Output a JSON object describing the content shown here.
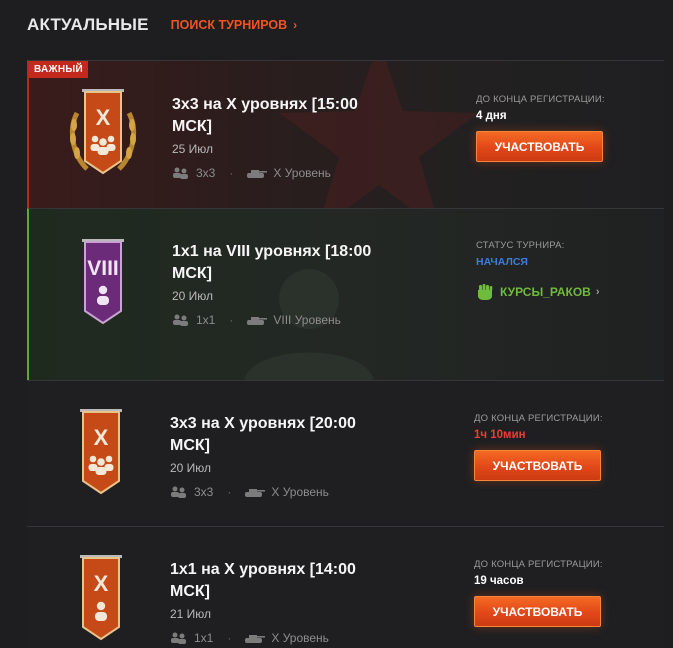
{
  "header": {
    "title": "АКТУАЛЬНЫЕ",
    "search_link": "ПОИСК ТУРНИРОВ"
  },
  "colors": {
    "accent": "#f25322",
    "important": "#c32a1d",
    "started": "#5ea83a",
    "button": "#e2471a",
    "time_urgent": "#f03c33",
    "status_blue": "#3d7fd6"
  },
  "tournaments": [
    {
      "badge": "ВАЖНЫЙ",
      "emblem_tier": "X",
      "emblem_icon": "team-three-icon",
      "title": "3x3 на X уровнях [15:00 МСК]",
      "date": "25 Июл",
      "format": "3x3",
      "tier": "X Уровень",
      "right_label": "ДО КОНЦА РЕГИСТРАЦИИ:",
      "right_value": "4 дня",
      "button": "УЧАСТВОВАТЬ"
    },
    {
      "emblem_tier": "VIII",
      "emblem_icon": "single-player-icon",
      "title": "1x1 на VIII уровнях [18:00 МСК]",
      "date": "20 Июл",
      "format": "1x1",
      "tier": "VIII Уровень",
      "right_label": "СТАТУС ТУРНИРА:",
      "right_value": "НАЧАЛСЯ",
      "stream_link": "КУРСЫ_РАКОВ"
    },
    {
      "emblem_tier": "X",
      "emblem_icon": "team-three-icon",
      "title": "3x3 на X уровнях [20:00 МСК]",
      "date": "20 Июл",
      "format": "3x3",
      "tier": "X Уровень",
      "right_label": "ДО КОНЦА РЕГИСТРАЦИИ:",
      "right_value": "1ч 10мин",
      "button": "УЧАСТВОВАТЬ"
    },
    {
      "emblem_tier": "X",
      "emblem_icon": "single-player-icon",
      "title": "1x1 на X уровнях [14:00 МСК]",
      "date": "21 Июл",
      "format": "1x1",
      "tier": "X Уровень",
      "right_label": "ДО КОНЦА РЕГИСТРАЦИИ:",
      "right_value": "19 часов",
      "button": "УЧАСТВОВАТЬ"
    }
  ]
}
